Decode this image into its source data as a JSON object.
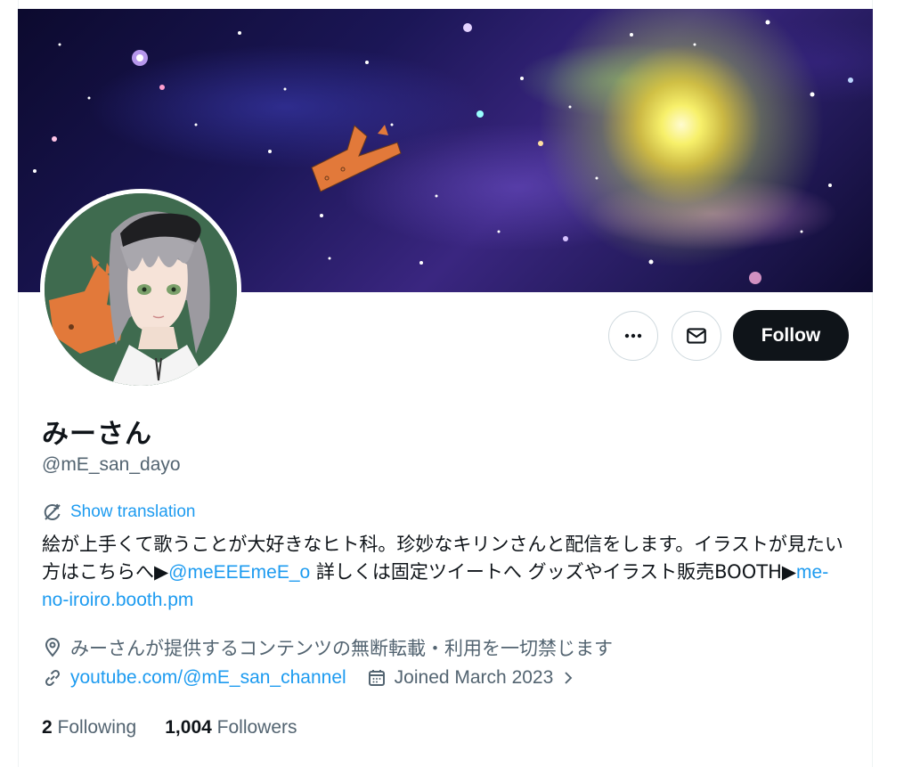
{
  "profile": {
    "display_name": "みーさん",
    "handle": "@mE_san_dayo"
  },
  "actions": {
    "more_icon": "more-horizontal-icon",
    "message_icon": "mail-icon",
    "follow_label": "Follow"
  },
  "bio": {
    "translate_label": "Show translation",
    "part1": "絵が上手くて歌うことが大好きなヒト科。珍妙なキリンさんと配信をします。イラストが見たい方はこちらへ▶",
    "mention": "@meEEEmeE_o",
    "part2": " 詳しくは固定ツイートへ グッズやイラスト販売BOOTH▶",
    "link": "me-no-iroiro.booth.pm"
  },
  "meta": {
    "location": "みーさんが提供するコンテンツの無断転載・利用を一切禁じます",
    "website": "youtube.com/@mE_san_channel",
    "joined": "Joined March 2023"
  },
  "stats": {
    "following_count": "2",
    "following_label": "Following",
    "followers_count": "1,004",
    "followers_label": "Followers"
  },
  "colors": {
    "accent": "#1d9bf0",
    "text_primary": "#0f1419",
    "text_secondary": "#536471",
    "follow_bg": "#0f1419"
  }
}
